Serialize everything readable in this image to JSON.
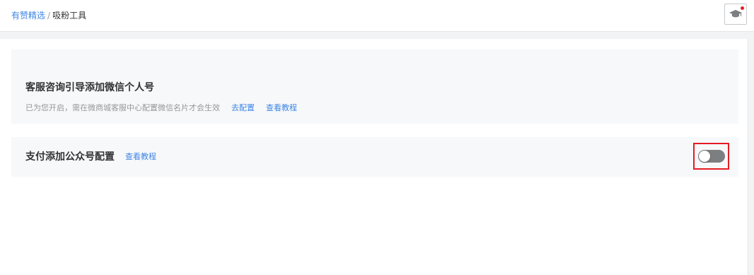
{
  "breadcrumb": {
    "root": "有赞精选",
    "separator": "/",
    "current": "吸粉工具"
  },
  "header": {
    "help_icon": "graduation-cap-icon",
    "notification_dot_color": "#e51c23"
  },
  "wechat_card": {
    "title": "客服咨询引导添加微信个人号",
    "description": "已为您开启，需在微商城客服中心配置微信名片才会生效",
    "configure_link": "去配置",
    "tutorial_link": "查看教程"
  },
  "pay_card": {
    "title": "支付添加公众号配置",
    "tutorial_link": "查看教程",
    "switch_on": false
  },
  "colors": {
    "link": "#3d85e6",
    "highlight": "#e51c23",
    "switch_off": "#7d7e80"
  }
}
